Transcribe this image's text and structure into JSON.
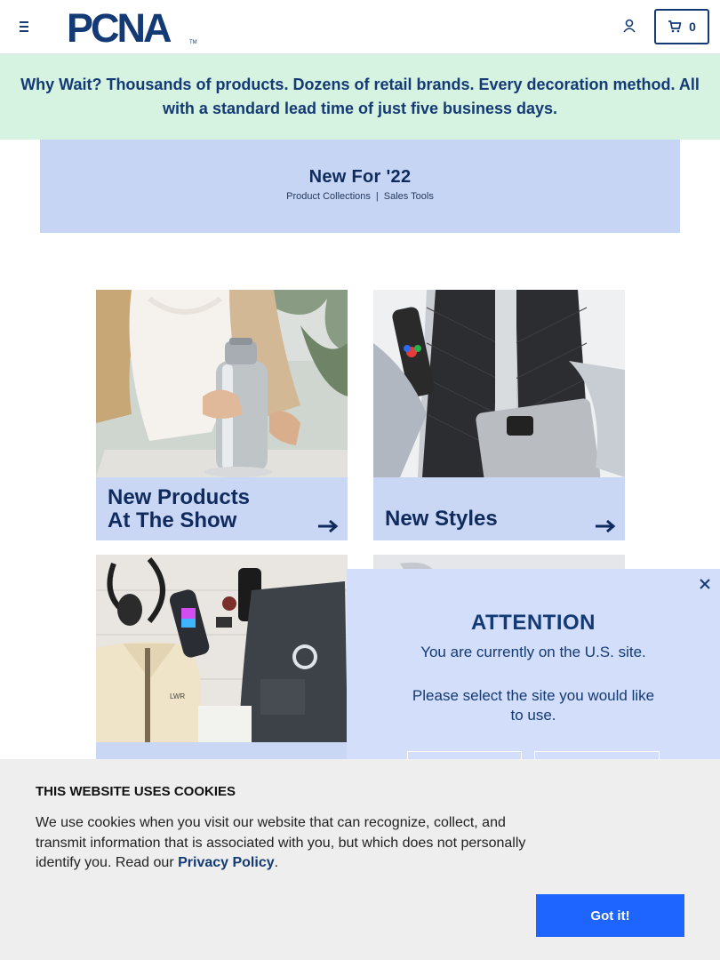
{
  "header": {
    "logo_text": "PCNA",
    "cart_count": "0",
    "icons": {
      "menu": "hamburger-icon",
      "account": "user-icon",
      "cart": "cart-icon"
    }
  },
  "promo": {
    "text": "Why Wait? Thousands of products. Dozens of retail brands. Every decoration method. All with a standard lead time of just five business days."
  },
  "hero": {
    "title": "New For '22",
    "link1": "Product Collections",
    "separator": "|",
    "link2": "Sales Tools"
  },
  "tiles": [
    {
      "label": "New Products\nAt The Show"
    },
    {
      "label": "New Styles"
    },
    {
      "label": ""
    },
    {
      "label": ""
    }
  ],
  "attention": {
    "title": "ATTENTION",
    "line1": "You are currently on the U.S. site.",
    "line2": "Please select the site you would like to use.",
    "close_glyph": "×"
  },
  "cookie": {
    "title": "THIS WEBSITE USES COOKIES",
    "text_before": "We use cookies when you visit our website that can recognize, collect, and transmit information that is associated with you, but which does not personally identify you. Read our ",
    "link": "Privacy Policy",
    "text_after": ".",
    "button": "Got it!"
  },
  "colors": {
    "brand_blue": "#143a75",
    "promo_bg": "#d6f2e0",
    "hero_bg": "#c7d5f4",
    "modal_bg": "#d2defa",
    "cookie_button": "#1e64ff"
  }
}
